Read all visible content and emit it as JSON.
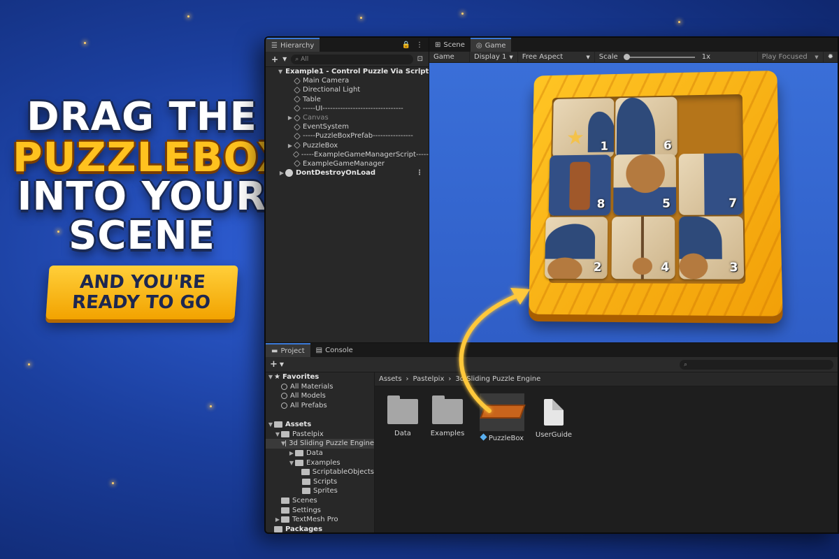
{
  "headline": {
    "line1": "DRAG THE",
    "line2": "PUZZLEBOX",
    "line3": "INTO YOUR",
    "line4": "SCENE",
    "ribbon_line1": "AND YOU'RE",
    "ribbon_line2": "READY TO GO"
  },
  "hierarchy": {
    "tab_label": "Hierarchy",
    "add_label": "+",
    "search_placeholder": "All",
    "items": [
      {
        "label": "Example1 - Control Puzzle Via Script",
        "depth": 0,
        "kind": "scene"
      },
      {
        "label": "Main Camera",
        "depth": 1,
        "kind": "object"
      },
      {
        "label": "Directional Light",
        "depth": 1,
        "kind": "object"
      },
      {
        "label": "Table",
        "depth": 1,
        "kind": "object"
      },
      {
        "label": "-----UI--------------------------------",
        "depth": 1,
        "kind": "object"
      },
      {
        "label": "Canvas",
        "depth": 1,
        "kind": "object"
      },
      {
        "label": "EventSystem",
        "depth": 1,
        "kind": "object"
      },
      {
        "label": "-----PuzzleBoxPrefab----------------",
        "depth": 1,
        "kind": "object"
      },
      {
        "label": "PuzzleBox",
        "depth": 1,
        "kind": "object"
      },
      {
        "label": "-----ExampleGameManagerScript-----",
        "depth": 1,
        "kind": "object"
      },
      {
        "label": "ExampleGameManager",
        "depth": 1,
        "kind": "object"
      },
      {
        "label": "DontDestroyOnLoad",
        "depth": 0,
        "kind": "scene"
      }
    ]
  },
  "gameview": {
    "tabs": {
      "scene": "Scene",
      "game": "Game"
    },
    "toolbar": {
      "mode": "Game",
      "display": "Display 1",
      "aspect": "Free Aspect",
      "scale_label": "Scale",
      "scale_value": "1x",
      "play_mode": "Play Focused"
    },
    "tile_numbers": [
      "1",
      "6",
      "8",
      "5",
      "7",
      "2",
      "4",
      "3"
    ]
  },
  "project": {
    "tabs": {
      "project": "Project",
      "console": "Console"
    },
    "add_label": "+",
    "tree": [
      {
        "label": "Favorites",
        "depth": 0,
        "kind": "favorites"
      },
      {
        "label": "All Materials",
        "depth": 1,
        "kind": "search"
      },
      {
        "label": "All Models",
        "depth": 1,
        "kind": "search"
      },
      {
        "label": "All Prefabs",
        "depth": 1,
        "kind": "search"
      },
      {
        "label": "",
        "depth": 0,
        "kind": "spacer"
      },
      {
        "label": "Assets",
        "depth": 0,
        "kind": "folder-open"
      },
      {
        "label": "Pastelpix",
        "depth": 1,
        "kind": "folder-open"
      },
      {
        "label": "3d Sliding Puzzle Engine",
        "depth": 2,
        "kind": "folder-open"
      },
      {
        "label": "Data",
        "depth": 3,
        "kind": "folder"
      },
      {
        "label": "Examples",
        "depth": 3,
        "kind": "folder-open"
      },
      {
        "label": "ScriptableObjects",
        "depth": 4,
        "kind": "folder"
      },
      {
        "label": "Scripts",
        "depth": 4,
        "kind": "folder"
      },
      {
        "label": "Sprites",
        "depth": 4,
        "kind": "folder"
      },
      {
        "label": "Scenes",
        "depth": 1,
        "kind": "folder"
      },
      {
        "label": "Settings",
        "depth": 1,
        "kind": "folder"
      },
      {
        "label": "TextMesh Pro",
        "depth": 1,
        "kind": "folder"
      },
      {
        "label": "Packages",
        "depth": 0,
        "kind": "folder"
      }
    ],
    "breadcrumbs": [
      "Assets",
      "Pastelpix",
      "3d Sliding Puzzle Engine"
    ],
    "assets": [
      {
        "label": "Data",
        "kind": "folder"
      },
      {
        "label": "Examples",
        "kind": "folder"
      },
      {
        "label": "PuzzleBox",
        "kind": "prefab"
      },
      {
        "label": "UserGuide",
        "kind": "document"
      }
    ]
  }
}
